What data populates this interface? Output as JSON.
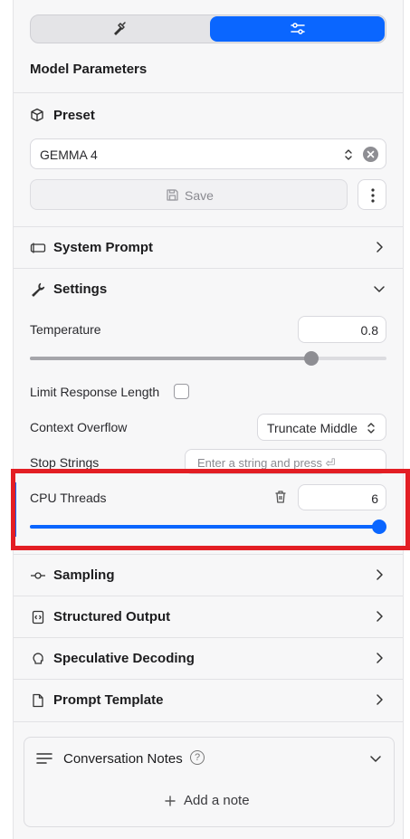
{
  "tabs": [
    {
      "icon": "hammer-icon",
      "selected": false
    },
    {
      "icon": "sliders-icon",
      "selected": true
    }
  ],
  "panel_title": "Model Parameters",
  "preset": {
    "label": "Preset",
    "value": "GEMMA 4",
    "save_label": "Save"
  },
  "system_prompt": {
    "label": "System Prompt"
  },
  "settings": {
    "label": "Settings",
    "temperature": {
      "label": "Temperature",
      "value": "0.8",
      "fraction": 0.79
    },
    "limit_response_length": {
      "label": "Limit Response Length",
      "checked": false
    },
    "context_overflow": {
      "label": "Context Overflow",
      "value": "Truncate Middle"
    },
    "stop_strings": {
      "label": "Stop Strings",
      "placeholder": "Enter a string and press ⏎"
    },
    "cpu_threads": {
      "label": "CPU Threads",
      "value": "6",
      "fraction": 1.0
    }
  },
  "sections": [
    {
      "label": "Sampling",
      "icon": "sampling-icon"
    },
    {
      "label": "Structured Output",
      "icon": "code-file-icon"
    },
    {
      "label": "Speculative Decoding",
      "icon": "brain-icon"
    },
    {
      "label": "Prompt Template",
      "icon": "document-icon"
    }
  ],
  "notes": {
    "label": "Conversation Notes",
    "add_label": "Add a note"
  },
  "colors": {
    "accent": "#0a66ff",
    "highlight": "#e31e24"
  }
}
